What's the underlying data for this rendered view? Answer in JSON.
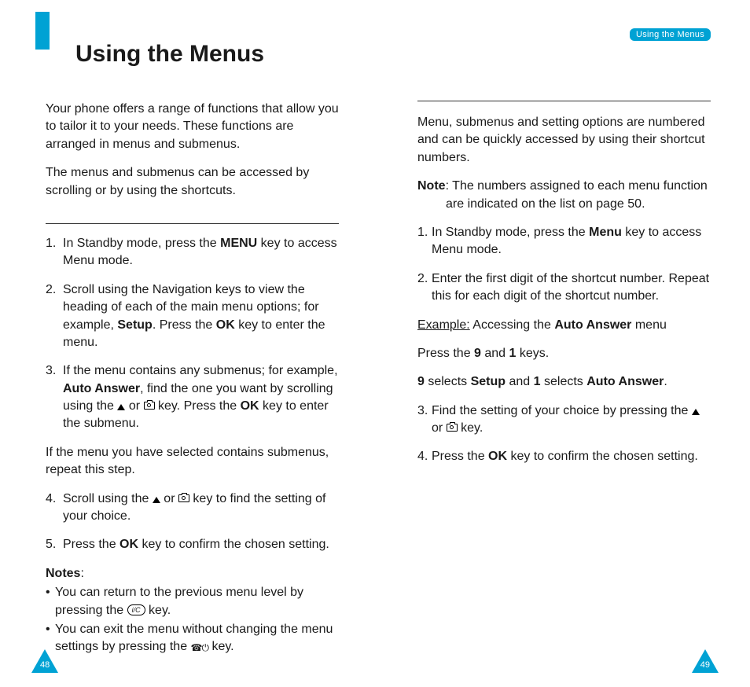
{
  "header": {
    "pill": "Using the Menus",
    "title": "Using the Menus"
  },
  "left": {
    "intro1": "Your phone offers a range of functions that allow you to tailor it to your needs. These functions are arranged in menus and submenus.",
    "intro2": "The menus and submenus can be accessed by scrolling or by using the shortcuts.",
    "steps": {
      "s1_a": "In Standby mode, press the ",
      "s1_b": "MENU",
      "s1_c": " key to access Menu mode.",
      "s2_a": "Scroll using the Navigation keys to view the heading of each of the main menu options; for example, ",
      "s2_b": "Setup",
      "s2_c": ". Press the ",
      "s2_d": "OK",
      "s2_e": " key to enter the menu.",
      "s3_a": "If the menu contains any submenus; for example, ",
      "s3_b": "Auto Answer",
      "s3_c": ", find the one you want by scrolling using the  ",
      "s3_d": "  or  ",
      "s3_e": "  key. Press the ",
      "s3_f": "OK",
      "s3_g": " key to enter the submenu.",
      "s3_sub": "If the menu you have selected contains submenus, repeat this step.",
      "s4_a": "Scroll using the  ",
      "s4_b": "  or  ",
      "s4_c": "  key to find the setting of your choice.",
      "s5_a": "Press the ",
      "s5_b": "OK",
      "s5_c": " key to confirm the chosen setting."
    },
    "notes_label": "Notes",
    "note1_a": "You can return to the previous menu level by pressing the  ",
    "note1_key": "i/C",
    "note1_b": " key.",
    "note2_a": "You can exit the menu without changing the menu settings by pressing the  ",
    "note2_b": "  key."
  },
  "right": {
    "intro": "Menu, submenus and setting options are numbered and can be quickly accessed by using their shortcut numbers.",
    "note_label": "Note",
    "note_body": ": The numbers assigned to each menu function are indicated on the list on page 50.",
    "s1_a": "In Standby mode, press the ",
    "s1_b": "Menu",
    "s1_c": " key to access Menu mode.",
    "s2": "Enter the first digit of the shortcut number. Repeat this for each digit of the shortcut number.",
    "ex_label": "Example:",
    "ex_a": " Accessing the ",
    "ex_b": "Auto Answer",
    "ex_c": " menu",
    "ex_press_a": "Press the ",
    "ex_press_b": "9",
    "ex_press_c": " and ",
    "ex_press_d": "1",
    "ex_press_e": " keys.",
    "ex_sel_a": "9",
    "ex_sel_b": " selects ",
    "ex_sel_c": "Setup",
    "ex_sel_d": " and ",
    "ex_sel_e": "1",
    "ex_sel_f": " selects ",
    "ex_sel_g": "Auto Answer",
    "ex_sel_h": ".",
    "s3_a": "Find the setting of your choice by pressing the  ",
    "s3_b": " or  ",
    "s3_c": "  key.",
    "s4_a": "Press the ",
    "s4_b": "OK",
    "s4_c": " key to confirm the chosen setting."
  },
  "page_numbers": {
    "left": "48",
    "right": "49"
  }
}
